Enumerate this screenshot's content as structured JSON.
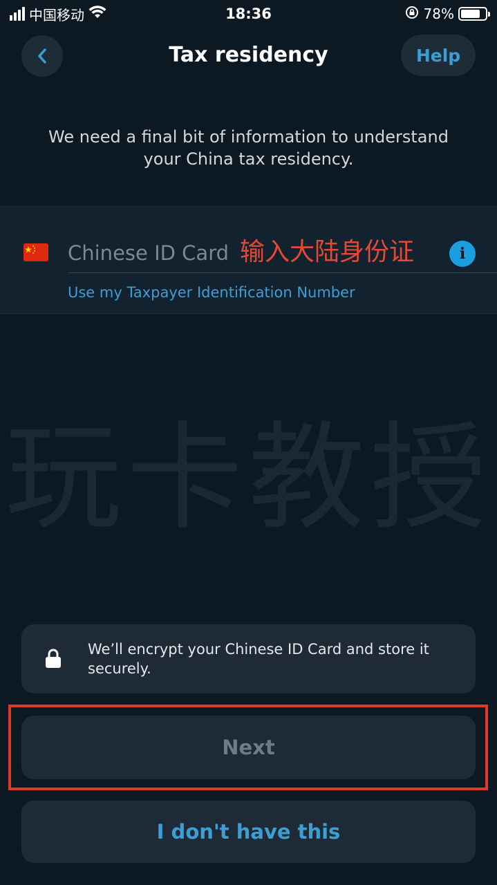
{
  "status_bar": {
    "carrier": "中国移动",
    "time": "18:36",
    "battery": "78%",
    "battery_level": 0.78
  },
  "header": {
    "title": "Tax residency",
    "help_label": "Help",
    "back_icon": "chevron-left-icon"
  },
  "intro": {
    "text": "We need a final bit of information to understand your China tax residency."
  },
  "id_field": {
    "flag_icon": "china-flag-icon",
    "placeholder": "Chinese ID Card",
    "value": "",
    "annotation": "输入大陆身份证",
    "info_icon": "info-icon",
    "alt_link": "Use my Taxpayer Identification Number"
  },
  "watermark": {
    "text": "玩卡教授"
  },
  "encrypt_note": {
    "icon": "lock-icon",
    "text": "We’ll encrypt your Chinese ID Card and store it securely."
  },
  "actions": {
    "next_label": "Next",
    "no_id_label": "I don't have this"
  },
  "colors": {
    "background": "#0c1822",
    "accent": "#3d9ed4",
    "annotation_red": "#e34a35"
  }
}
